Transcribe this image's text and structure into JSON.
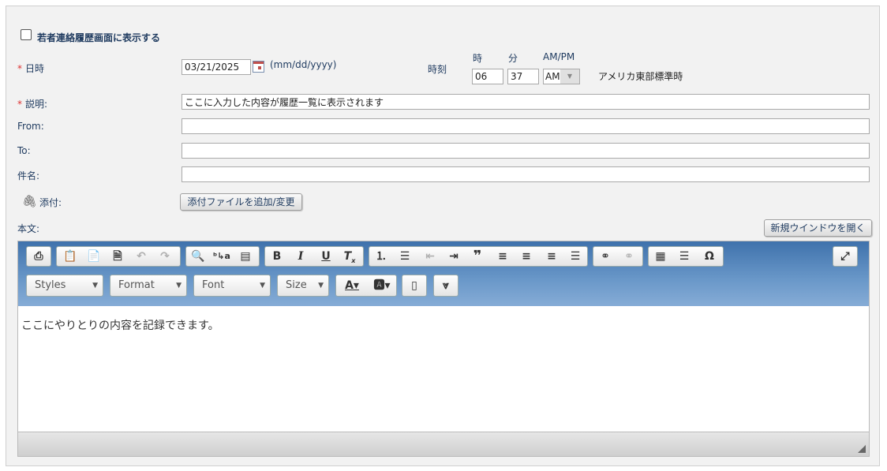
{
  "form": {
    "show_history_label": "若者連絡履歴画面に表示する",
    "date_label": "日時",
    "date_value": "03/21/2025",
    "date_format": "(mm/dd/yyyy)",
    "time_label": "時刻",
    "hour_header": "時",
    "minute_header": "分",
    "ampm_header": "AM/PM",
    "hour_value": "06",
    "minute_value": "37",
    "ampm_value": "AM",
    "timezone": "アメリカ東部標準時",
    "description_label": "説明:",
    "description_value": "ここに入力した内容が履歴一覧に表示されます",
    "from_label": "From:",
    "to_label": "To:",
    "subject_label": "件名:",
    "attach_label": "添付:",
    "attach_button": "添付ファイルを追加/変更",
    "body_label": "本文:",
    "new_window_button": "新規ウインドウを開く",
    "required_mark": "*"
  },
  "editor": {
    "styles": "Styles",
    "format": "Format",
    "font": "Font",
    "size": "Size",
    "content": "ここにやりとりの内容を記録できます。"
  }
}
